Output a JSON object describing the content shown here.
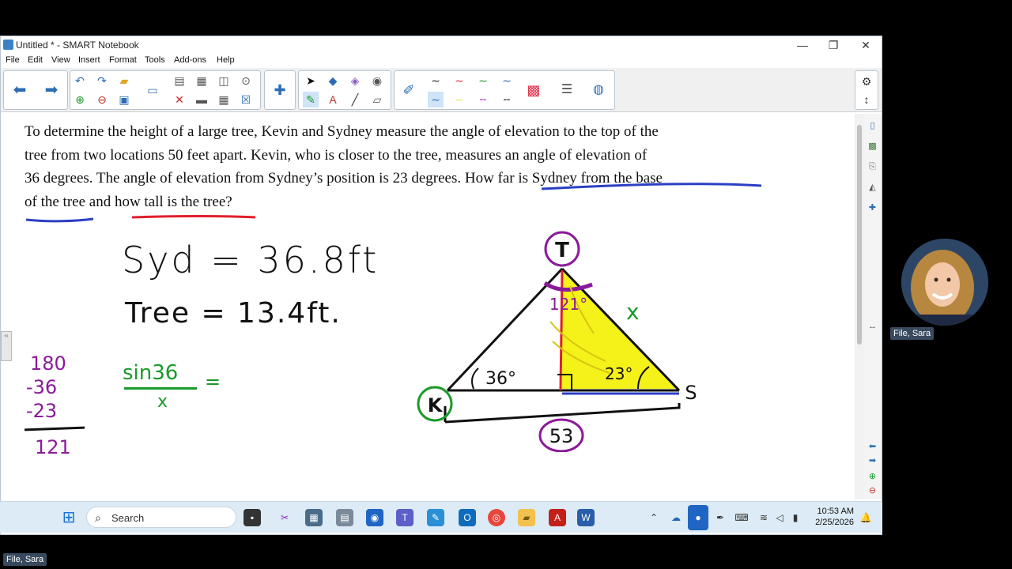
{
  "window": {
    "title": "Untitled * - SMART Notebook",
    "controls": {
      "minimize": "—",
      "restore": "❐",
      "close": "✕"
    }
  },
  "menu": [
    "File",
    "Edit",
    "View",
    "Insert",
    "Format",
    "Tools",
    "Add-ons",
    "Help"
  ],
  "problem": {
    "lines": [
      "To determine the height of a large tree, Kevin and Sydney measure the angle of elevation to the top of the",
      "tree from two locations 50 feet apart. Kevin, who is closer to the tree, measures an angle of elevation of",
      "36 degrees. The angle of elevation from Sydney’s position is 23 degrees. How far is Sydney from the base",
      "of the tree and how tall is the tree?"
    ]
  },
  "handwriting": {
    "answer_syd": "Syd = 36.8ft",
    "answer_tree": "Tree = 13.4ft.",
    "calc": [
      "180",
      "-36",
      "-23",
      "121"
    ],
    "sin_num": "sin36",
    "sin_den": "x",
    "sin_eq": "="
  },
  "diagram": {
    "label_t": "T",
    "label_k": "K",
    "label_s": "S",
    "angle_top": "121°",
    "angle_k": "36°",
    "angle_s": "23°",
    "label_x": "x",
    "distance": "53"
  },
  "taskbar": {
    "search_placeholder": "Search",
    "time": "10:53 AM",
    "date": "2/25/2026"
  },
  "participants": {
    "webcam_name": "File, Sara",
    "bottom_name": "File, Sara"
  },
  "colors": {
    "accent_blue": "#2b6cb5",
    "pen_green": "#1a9a2a",
    "pen_purple": "#8b1a9a",
    "highlight_yellow": "#f5f21a"
  }
}
